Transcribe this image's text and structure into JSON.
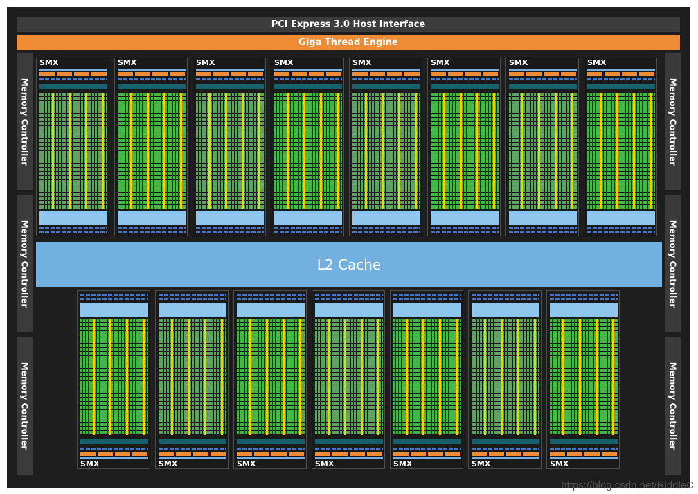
{
  "diagram": {
    "pcie_label": "PCI Express 3.0 Host Interface",
    "giga_label": "Giga Thread Engine",
    "l2_label": "L2 Cache",
    "memory_controller_label": "Memory Controller",
    "smx_label": "SMX",
    "top_smx_count": 8,
    "bottom_smx_count": 7
  },
  "colors": {
    "background": "#1e1e1e",
    "giga_thread": "#f08c35",
    "l2_cache": "#72b0e0",
    "core_green": "#47b247",
    "core_yellow": "#ffcc00"
  },
  "watermark": "https://blog.csdn.net/RiddleC"
}
